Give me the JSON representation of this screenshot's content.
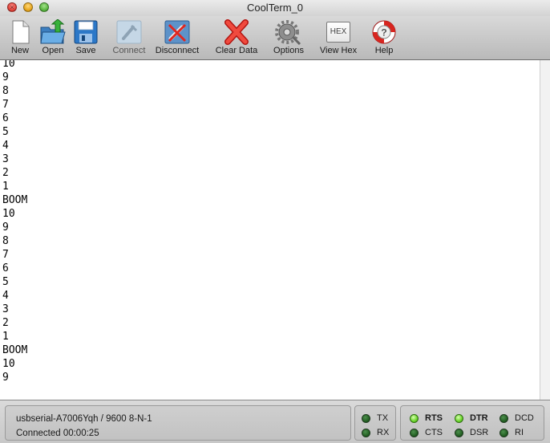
{
  "window": {
    "title": "CoolTerm_0"
  },
  "toolbar": {
    "new_label": "New",
    "open_label": "Open",
    "save_label": "Save",
    "connect_label": "Connect",
    "disconnect_label": "Disconnect",
    "clear_data_label": "Clear Data",
    "options_label": "Options",
    "view_hex_label": "View Hex",
    "view_hex_icon_text": "HEX",
    "help_label": "Help"
  },
  "terminal": {
    "lines": [
      "10",
      "9",
      "8",
      "7",
      "6",
      "5",
      "4",
      "3",
      "2",
      "1",
      "BOOM",
      "10",
      "9",
      "8",
      "7",
      "6",
      "5",
      "4",
      "3",
      "2",
      "1",
      "BOOM",
      "10",
      "9"
    ]
  },
  "status": {
    "port_info": "usbserial-A7006Yqh / 9600 8-N-1",
    "connection": "Connected 00:00:25"
  },
  "indicators": {
    "tx": {
      "label": "TX",
      "state": "off"
    },
    "rx": {
      "label": "RX",
      "state": "off"
    },
    "rts": {
      "label": "RTS",
      "state": "on"
    },
    "cts": {
      "label": "CTS",
      "state": "off"
    },
    "dtr": {
      "label": "DTR",
      "state": "on"
    },
    "dsr": {
      "label": "DSR",
      "state": "off"
    },
    "dcd": {
      "label": "DCD",
      "state": "off"
    },
    "ri": {
      "label": "RI",
      "state": "off"
    }
  }
}
